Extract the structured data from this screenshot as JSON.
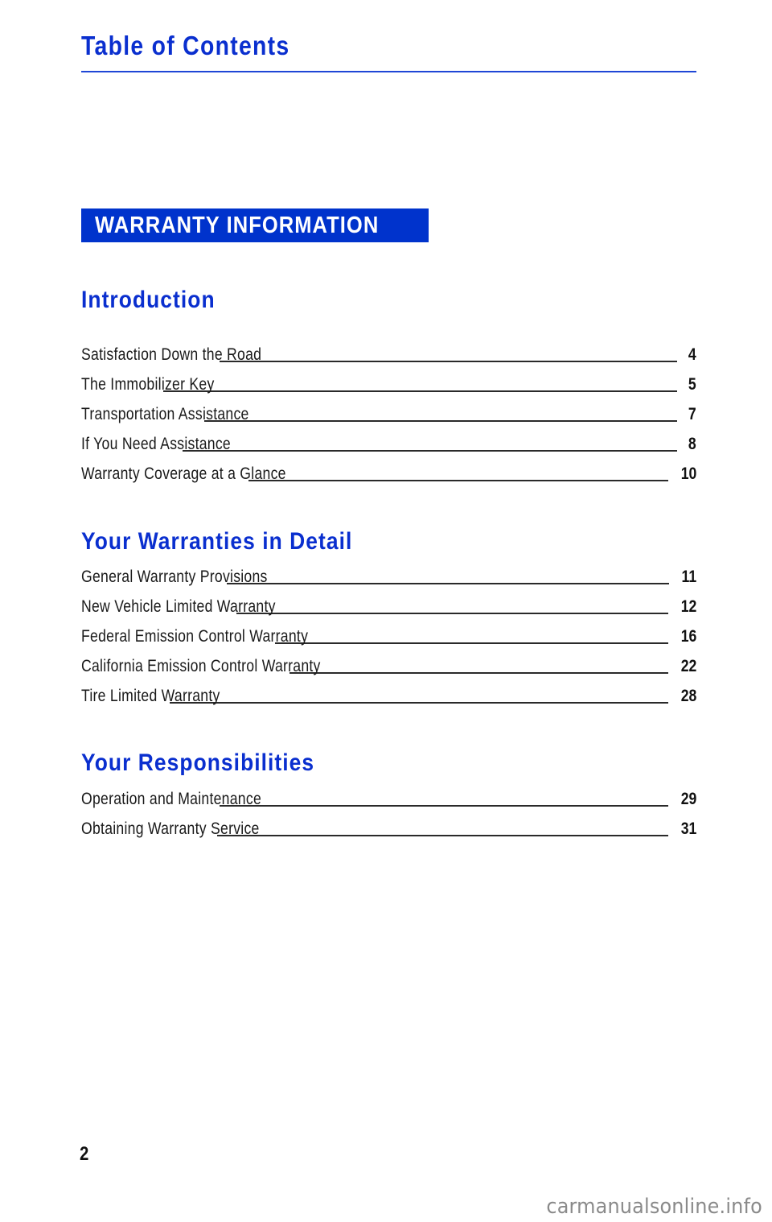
{
  "page": {
    "title": "Table of Contents",
    "band_label": "WARRANTY INFORMATION",
    "page_number": "2",
    "watermark": "carmanualsonline.info"
  },
  "colors": {
    "heading_blue": "#0a2fcf",
    "band_blue": "#0033cc",
    "text": "#1a1a1a"
  },
  "sections": [
    {
      "heading": "Introduction",
      "entries": [
        {
          "label": "Satisfaction Down the Road",
          "page": "4"
        },
        {
          "label": "The Immobilizer Key",
          "page": "5"
        },
        {
          "label": "Transportation Assistance",
          "page": "7"
        },
        {
          "label": "If You Need Assistance",
          "page": "8"
        },
        {
          "label": "Warranty Coverage at a Glance",
          "page": "10"
        }
      ]
    },
    {
      "heading": "Your Warranties in Detail",
      "entries": [
        {
          "label": "General Warranty Provisions",
          "page": "11"
        },
        {
          "label": "New Vehicle Limited Warranty",
          "page": "12"
        },
        {
          "label": "Federal Emission Control Warranty",
          "page": "16"
        },
        {
          "label": "California Emission Control Warranty",
          "page": "22"
        },
        {
          "label": "Tire Limited Warranty",
          "page": "28"
        }
      ]
    },
    {
      "heading": "Your Responsibilities",
      "entries": [
        {
          "label": "Operation and Maintenance",
          "page": "29"
        },
        {
          "label": "Obtaining Warranty Service",
          "page": "31"
        }
      ]
    }
  ]
}
